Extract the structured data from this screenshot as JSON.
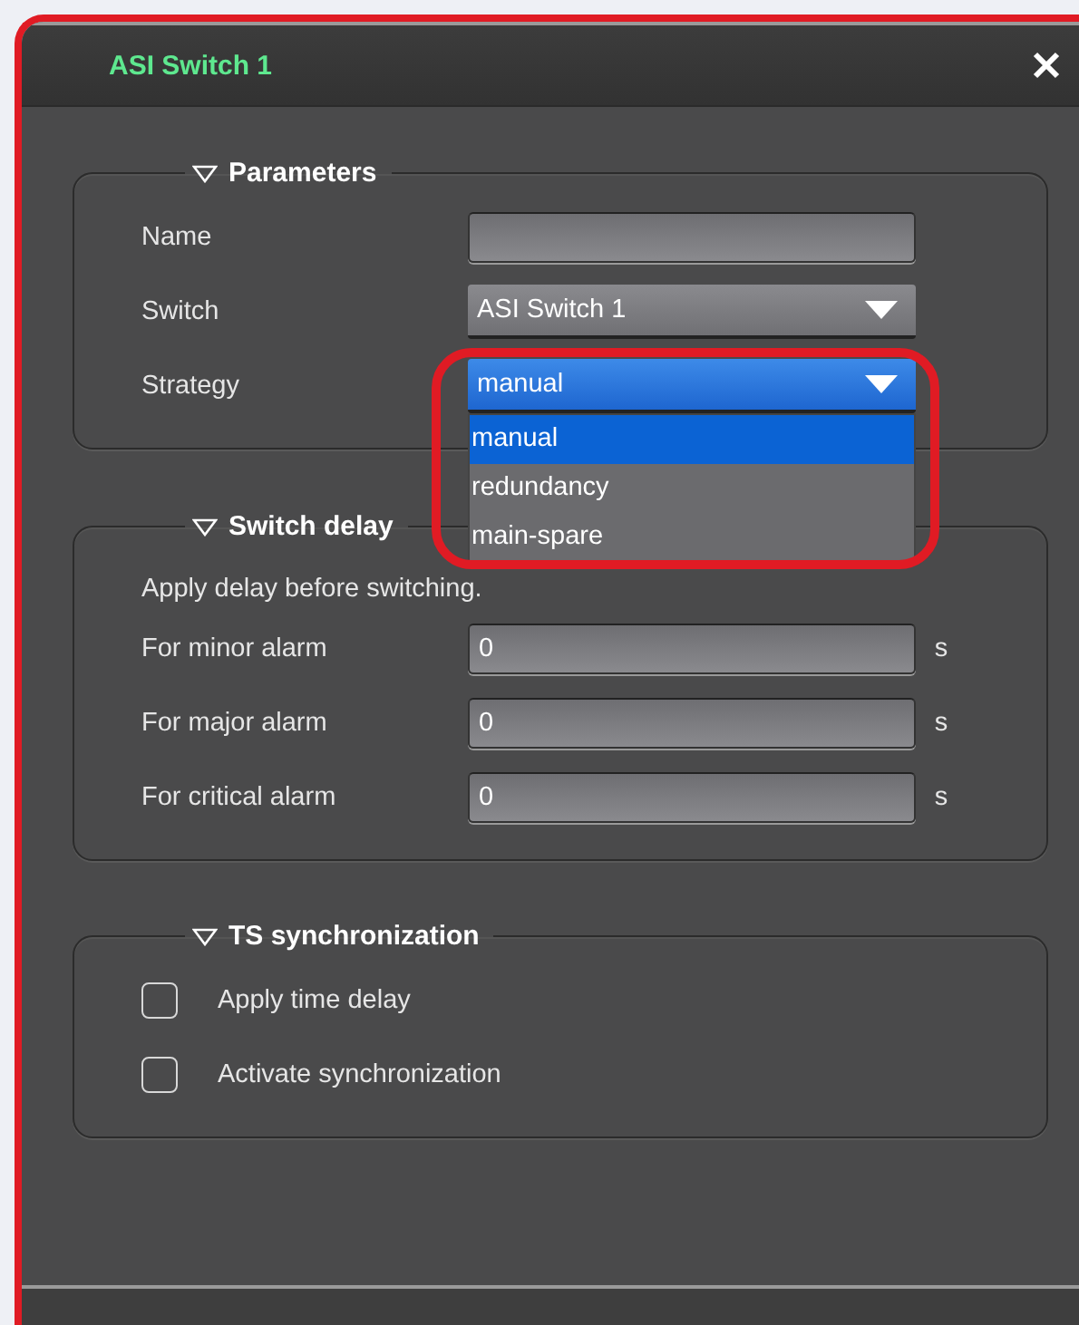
{
  "window": {
    "title": "ASI Switch 1"
  },
  "sections": [
    {
      "title": "Parameters",
      "expanded": true,
      "fields": [
        {
          "kind": "text",
          "label": "Name"
        },
        {
          "kind": "combo",
          "label": "Switch",
          "value": "ASI Switch 1",
          "focused": false,
          "open": false
        },
        {
          "kind": "combo",
          "label": "Strategy",
          "value": "manual",
          "focused": true,
          "open": true,
          "options": [
            {
              "label": "manual",
              "selected": true
            },
            {
              "label": "redundancy",
              "selected": false
            },
            {
              "label": "main-spare",
              "selected": false
            }
          ]
        }
      ]
    },
    {
      "title": "Switch delay",
      "expanded": true,
      "note": "Apply delay before switching.",
      "fields": [
        {
          "kind": "text",
          "label": "For minor alarm",
          "value": "0",
          "unit": "s"
        },
        {
          "kind": "text",
          "label": "For major alarm",
          "value": "0",
          "unit": "s"
        },
        {
          "kind": "text",
          "label": "For critical alarm",
          "value": "0",
          "unit": "s"
        }
      ]
    },
    {
      "title": "TS synchronization",
      "expanded": true,
      "fields": [
        {
          "kind": "check",
          "label": "Apply time delay",
          "checked": false
        },
        {
          "kind": "check",
          "label": "Activate synchronization",
          "checked": false
        }
      ]
    }
  ]
}
